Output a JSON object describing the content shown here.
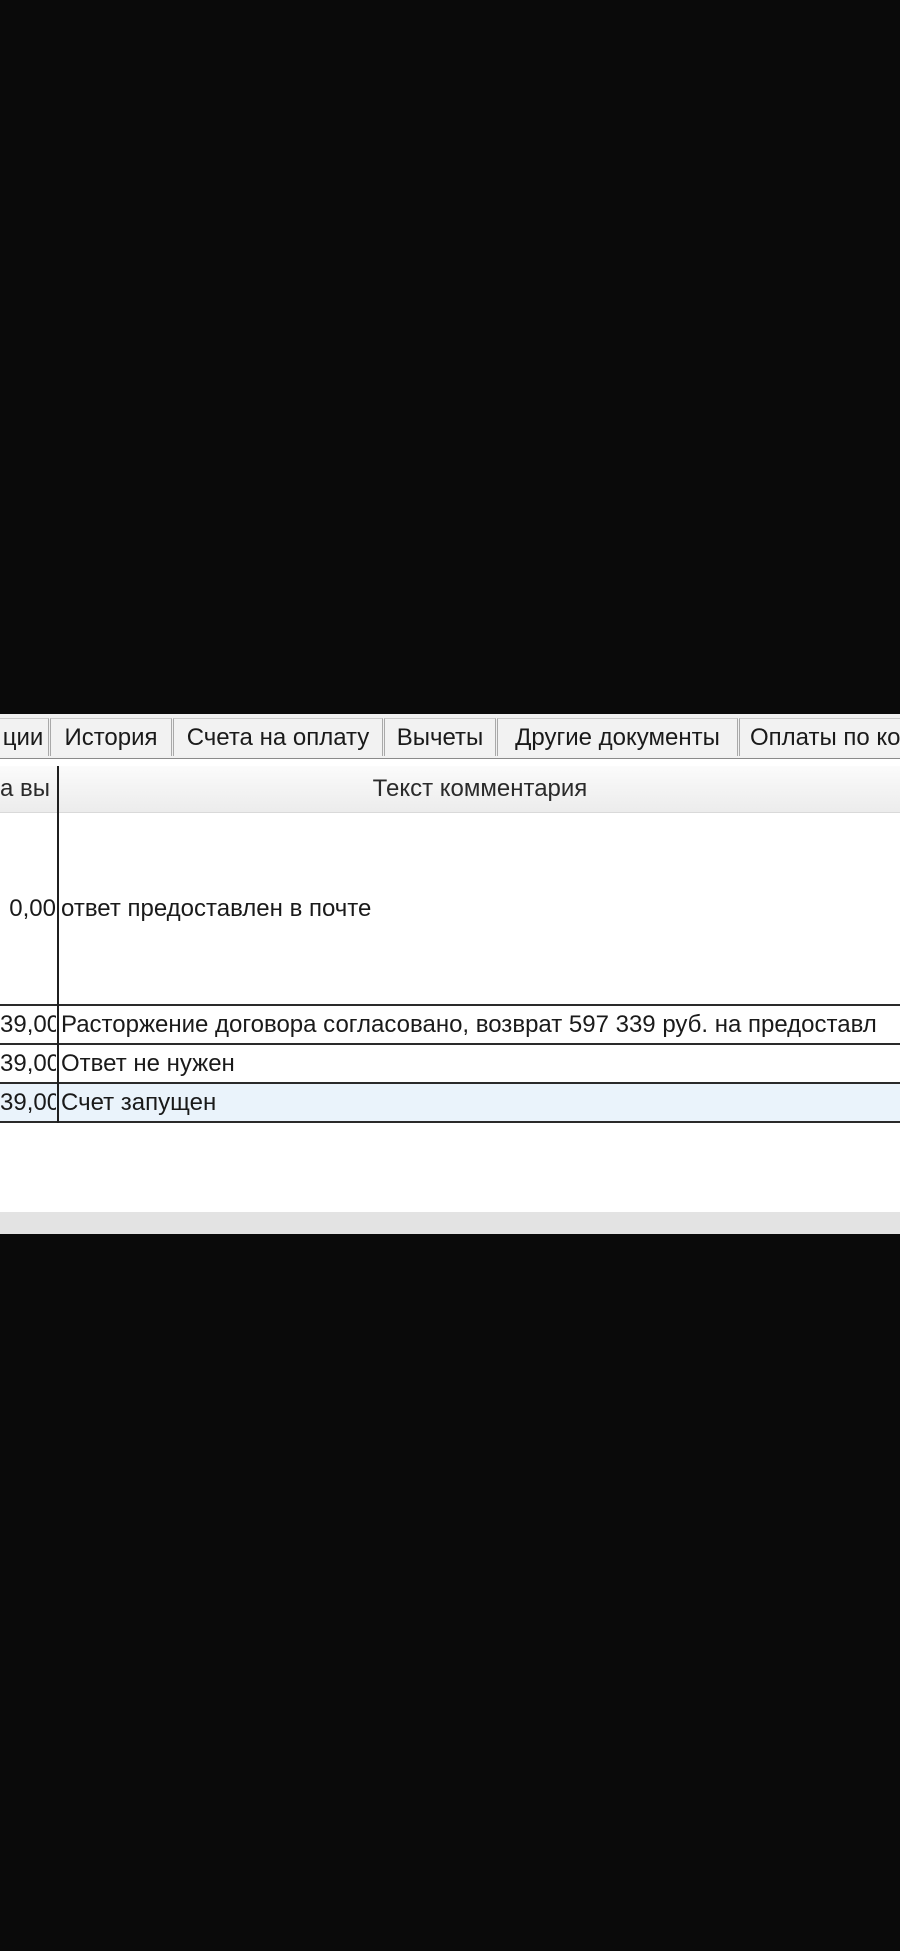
{
  "tabs": [
    {
      "label": "ции"
    },
    {
      "label": "История"
    },
    {
      "label": "Счета на оплату"
    },
    {
      "label": "Вычеты"
    },
    {
      "label": "Другие документы"
    },
    {
      "label": "Оплаты по ко"
    }
  ],
  "table": {
    "headers": {
      "amount": "а вы",
      "comment": "Текст комментария"
    },
    "rows": [
      {
        "amount": "0,00",
        "comment": "ответ предоставлен в почте"
      },
      {
        "amount": "39,00",
        "comment": "Расторжение договора согласовано, возврат 597 339 руб. на предоставл"
      },
      {
        "amount": "39,00",
        "comment": "Ответ не нужен"
      },
      {
        "amount": "39,00",
        "comment": "Счет запущен"
      }
    ]
  },
  "colors": {
    "page_background": "#0a0a0a",
    "selected_row": "#eaf3fb",
    "table_background": "#ffffff"
  }
}
